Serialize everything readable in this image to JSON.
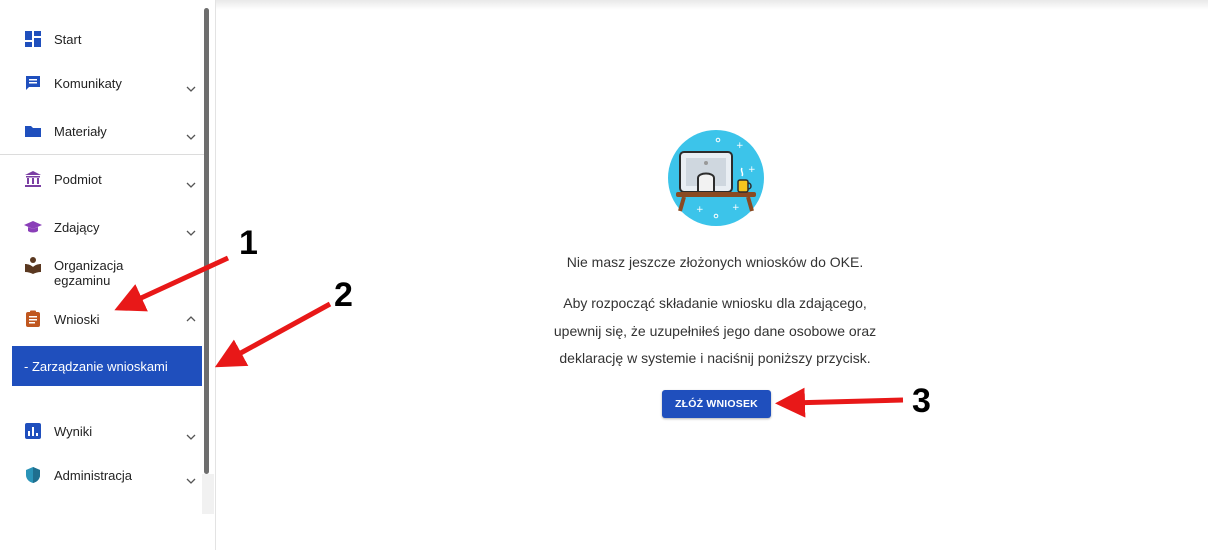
{
  "sidebar": {
    "items": [
      {
        "label": "Start",
        "icon": "dashboard-icon"
      },
      {
        "label": "Komunikaty",
        "icon": "message-icon"
      },
      {
        "label": "Materiały",
        "icon": "folder-icon"
      },
      {
        "label": "Podmiot",
        "icon": "institution-icon"
      },
      {
        "label": "Zdający",
        "icon": "graduation-cap-icon"
      },
      {
        "label": "Organizacja egzaminu",
        "icon": "reading-person-icon"
      },
      {
        "label": "Wnioski",
        "icon": "clipboard-icon"
      },
      {
        "label": "Wyniki",
        "icon": "bar-chart-icon"
      },
      {
        "label": "Administracja",
        "icon": "shield-icon"
      }
    ],
    "sub_items": [
      {
        "label": "- Zarządzanie wnioskami"
      }
    ]
  },
  "main": {
    "empty_message": "Nie masz jeszcze złożonych wniosków do OKE.",
    "instruction_lines": [
      "Aby rozpocząć składanie wniosku dla zdającego,",
      "upewnij się, że uzupełniłeś jego dane osobowe oraz",
      "deklarację w systemie i naciśnij poniższy przycisk."
    ],
    "submit_label": "ZŁÓŻ WNIOSEK"
  },
  "annotations": {
    "callouts": [
      "1",
      "2",
      "3"
    ],
    "arrow_color": "#e81818"
  },
  "colors": {
    "accent": "#1f4fbd",
    "illustration_bg": "#3cc4ea"
  }
}
